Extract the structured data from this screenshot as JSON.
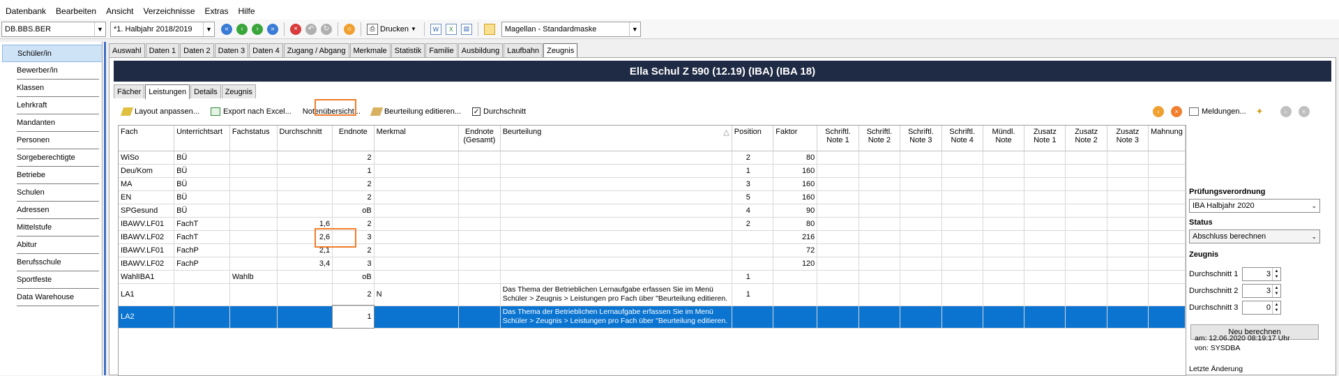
{
  "menu": [
    "Datenbank",
    "Bearbeiten",
    "Ansicht",
    "Verzeichnisse",
    "Extras",
    "Hilfe"
  ],
  "toolbar": {
    "db_select": "DB.BBS.BER",
    "period_select": "*1. Halbjahr 2018/2019",
    "print_label": "Drucken",
    "mask_select": "Magellan - Standardmaske"
  },
  "sidebar": {
    "items": [
      {
        "label": "Schüler/in",
        "active": true
      },
      {
        "label": "Bewerber/in"
      },
      {
        "label": "Klassen"
      },
      {
        "label": "Lehrkraft"
      },
      {
        "label": "Mandanten"
      },
      {
        "label": "Personen"
      },
      {
        "label": "Sorgeberechtigte"
      },
      {
        "label": "Betriebe"
      },
      {
        "label": "Schulen"
      },
      {
        "label": "Adressen"
      },
      {
        "label": "Mittelstufe"
      },
      {
        "label": "Abitur"
      },
      {
        "label": "Berufsschule"
      },
      {
        "label": "Sportfeste"
      },
      {
        "label": "Data Warehouse"
      }
    ]
  },
  "tabs": [
    "Auswahl",
    "Daten 1",
    "Daten 2",
    "Daten 3",
    "Daten 4",
    "Zugang / Abgang",
    "Merkmale",
    "Statistik",
    "Familie",
    "Ausbildung",
    "Laufbahn",
    "Zeugnis"
  ],
  "active_tab": "Zeugnis",
  "student": {
    "header": "Ella Schul Z 590 (12.19) (IBA) (IBA 18)"
  },
  "inner_tabs": [
    "Fächer",
    "Leistungen",
    "Details",
    "Zeugnis"
  ],
  "active_inner_tab": "Leistungen",
  "subtoolbar": {
    "layout": "Layout anpassen...",
    "export": "Export nach Excel...",
    "overview": "Notenübersicht...",
    "edit_assessment": "Beurteilung editieren...",
    "strikethrough": "Durchschnitt",
    "messages": "Meldungen..."
  },
  "grid": {
    "columns": [
      "Fach",
      "Unterrichtsart",
      "Fachstatus",
      "Durchschnitt",
      "Endnote",
      "Merkmal",
      "Endnote (Gesamt)",
      "Beurteilung",
      "Position",
      "Faktor",
      "Schriftl. Note 1",
      "Schriftl. Note 2",
      "Schriftl. Note 3",
      "Schriftl. Note 4",
      "Mündl. Note",
      "Zusatz Note 1",
      "Zusatz Note 2",
      "Zusatz Note 3",
      "Mahnung"
    ],
    "rows": [
      [
        "WiSo",
        "BÜ",
        "",
        "",
        "2",
        "",
        "",
        "",
        "2",
        "80"
      ],
      [
        "Deu/Kom",
        "BÜ",
        "",
        "",
        "1",
        "",
        "",
        "",
        "1",
        "160"
      ],
      [
        "MA",
        "BÜ",
        "",
        "",
        "2",
        "",
        "",
        "",
        "3",
        "160"
      ],
      [
        "EN",
        "BÜ",
        "",
        "",
        "2",
        "",
        "",
        "",
        "5",
        "160"
      ],
      [
        "SPGesund",
        "BÜ",
        "",
        "",
        "oB",
        "",
        "",
        "",
        "4",
        "90"
      ],
      [
        "IBAWV.LF01",
        "FachT",
        "",
        "1,6",
        "2",
        "",
        "",
        "",
        "2",
        "80"
      ],
      [
        "IBAWV.LF02",
        "FachT",
        "",
        "2,6",
        "3",
        "",
        "",
        "",
        "",
        "216"
      ],
      [
        "IBAWV.LF01",
        "FachP",
        "",
        "2,1",
        "2",
        "",
        "",
        "",
        "",
        "72"
      ],
      [
        "IBAWV.LF02",
        "FachP",
        "",
        "3,4",
        "3",
        "",
        "",
        "",
        "",
        "120"
      ],
      [
        "WahlIBA1",
        "",
        "Wahlb",
        "",
        "oB",
        "",
        "",
        "",
        "1",
        ""
      ],
      [
        "LA1",
        "",
        "",
        "",
        "2",
        "N",
        "",
        "Das Thema der Betrieblichen Lernaufgabe erfassen Sie im Menü Schüler > Zeugnis > Leistungen pro Fach über \"Beurteilung editieren.",
        "1",
        ""
      ],
      [
        "LA2",
        "",
        "",
        "",
        "1",
        "",
        "",
        "Das Thema der Betrieblichen Lernaufgabe erfassen Sie im Menü Schüler > Zeugnis > Leistungen pro Fach über \"Beurteilung editieren.",
        "",
        ""
      ]
    ]
  },
  "right_panel": {
    "pruefung_label": "Prüfungsverordnung",
    "pruefung_value": "IBA Halbjahr 2020",
    "status_label": "Status",
    "status_value": "Abschluss berechnen",
    "zeugnis_label": "Zeugnis",
    "d1_label": "Durchschnitt 1",
    "d1_value": "3",
    "d2_label": "Durchschnitt 2",
    "d2_value": "3",
    "d3_label": "Durchschnitt 3",
    "d3_value": "0",
    "recalc": "Neu berechnen",
    "last_change": "Letzte Änderung",
    "am": "am:   12.06.2020 08:19:17 Uhr",
    "von": "von:  SYSDBA"
  },
  "colors": {
    "header_bg": "#1f2a44",
    "selection": "#0a74d0",
    "highlight": "#f07d2a",
    "sidebar_accent": "#3c6fc4"
  }
}
